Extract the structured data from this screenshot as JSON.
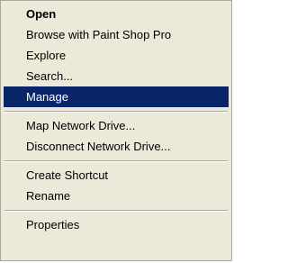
{
  "menu": {
    "groups": [
      {
        "items": [
          {
            "label": "Open",
            "bold": true
          },
          {
            "label": "Browse with Paint Shop Pro"
          },
          {
            "label": "Explore"
          },
          {
            "label": "Search..."
          },
          {
            "label": "Manage",
            "selected": true
          }
        ]
      },
      {
        "items": [
          {
            "label": "Map Network Drive..."
          },
          {
            "label": "Disconnect Network Drive..."
          }
        ]
      },
      {
        "items": [
          {
            "label": "Create Shortcut"
          },
          {
            "label": "Rename"
          }
        ]
      },
      {
        "items": [
          {
            "label": "Properties"
          }
        ]
      }
    ],
    "colors": {
      "background": "#ece9d8",
      "highlight": "#0a246a",
      "highlight_text": "#ffffff"
    }
  }
}
